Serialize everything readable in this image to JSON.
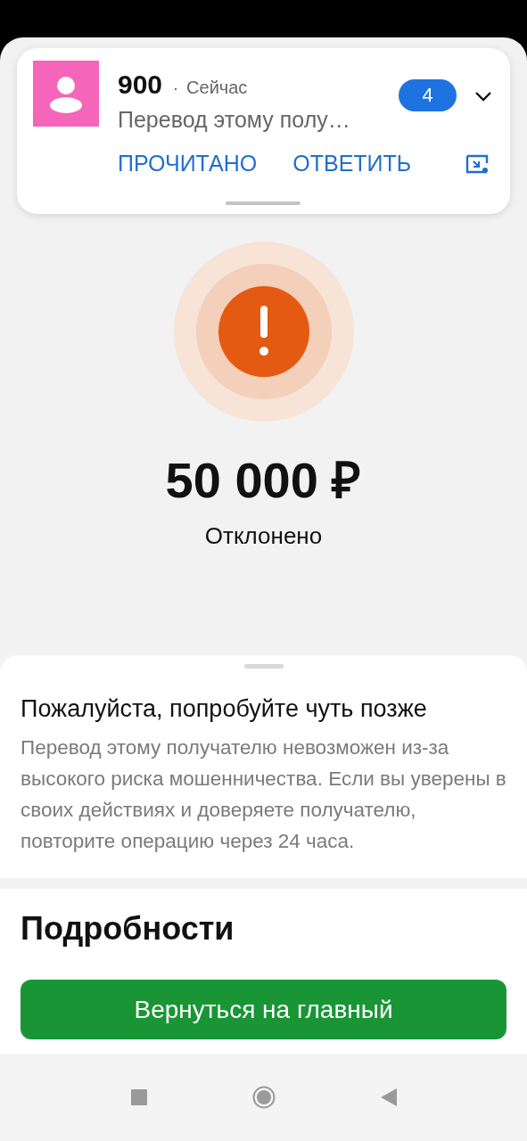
{
  "notification": {
    "sender": "900",
    "separator": "·",
    "time": "Сейчас",
    "message": "Перевод этому полу…",
    "count": "4",
    "actions": [
      "ПРОЧИТАНО",
      "ОТВЕТИТЬ"
    ]
  },
  "status": {
    "kind": "error",
    "amount": "50 000 ₽",
    "label": "Отклонено"
  },
  "sheet": {
    "title": "Пожалуйста, попробуйте чуть позже",
    "text": "Перевод этому получателю невозможен из-за высокого риска мошенничества. Если вы уверены в своих действиях и доверяете получателю, повторите операцию через 24 часа."
  },
  "details": {
    "title": "Подробности",
    "button": "Вернуться на главный"
  }
}
